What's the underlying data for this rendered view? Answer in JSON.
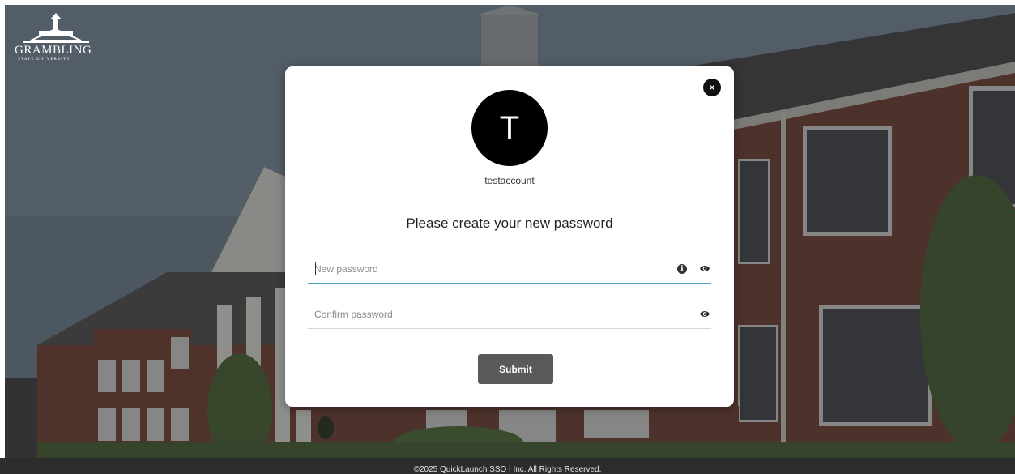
{
  "branding": {
    "logo_text": "GRAMBLING",
    "logo_subtext": "STATE UNIVERSITY"
  },
  "dialog": {
    "close_symbol": "×",
    "avatar_initial": "T",
    "username": "testaccount",
    "heading": "Please create your new password",
    "new_password": {
      "value": "",
      "placeholder": "New password"
    },
    "confirm_password": {
      "value": "",
      "placeholder": "Confirm password"
    },
    "submit_label": "Submit",
    "info_symbol": "i"
  },
  "footer": {
    "copyright": "©2025 QuickLaunch SSO | Inc. All Rights Reserved."
  },
  "colors": {
    "overlay": "#2b2b2b",
    "submit_button": "#5a5a5a",
    "active_underline": "#4fa3c7",
    "avatar": "#000000"
  }
}
